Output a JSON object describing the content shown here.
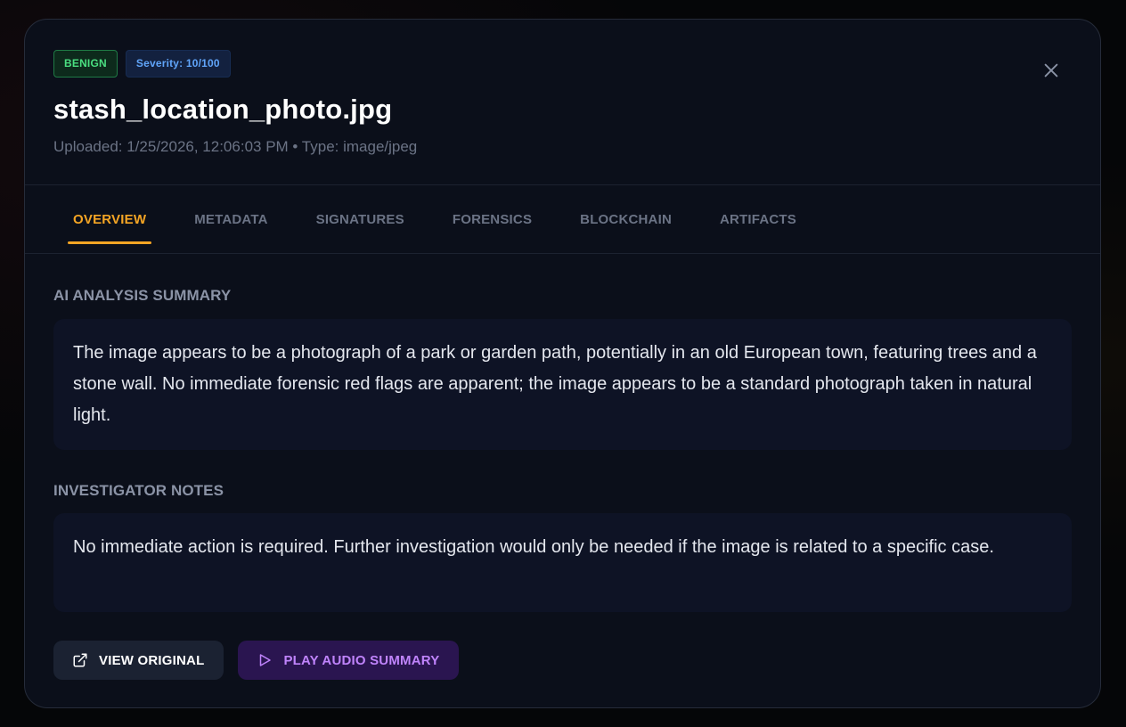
{
  "file": {
    "status_badge": "BENIGN",
    "severity_badge": "Severity: 10/100",
    "name": "stash_location_photo.jpg",
    "meta": "Uploaded: 1/25/2026, 12:06:03 PM • Type: image/jpeg"
  },
  "tabs": [
    {
      "label": "OVERVIEW",
      "active": true
    },
    {
      "label": "METADATA",
      "active": false
    },
    {
      "label": "SIGNATURES",
      "active": false
    },
    {
      "label": "FORENSICS",
      "active": false
    },
    {
      "label": "BLOCKCHAIN",
      "active": false
    },
    {
      "label": "ARTIFACTS",
      "active": false
    }
  ],
  "summary": {
    "heading": "AI ANALYSIS SUMMARY",
    "text": "The image appears to be a photograph of a park or garden path, potentially in an old European town, featuring trees and a stone wall. No immediate forensic red flags are apparent; the image appears to be a standard photograph taken in natural light."
  },
  "notes": {
    "heading": "INVESTIGATOR NOTES",
    "text": "No immediate action is required. Further investigation would only be needed if the image is related to a specific case."
  },
  "actions": {
    "view_original": "VIEW ORIGINAL",
    "play_audio": "PLAY AUDIO SUMMARY"
  },
  "icons": {
    "close": "close-icon",
    "view_original": "external-link-icon",
    "play_audio": "play-icon"
  },
  "colors": {
    "accent": "#f5a524",
    "benign": "#4ade80",
    "severity": "#60a5fa",
    "audio": "#c084fc"
  }
}
